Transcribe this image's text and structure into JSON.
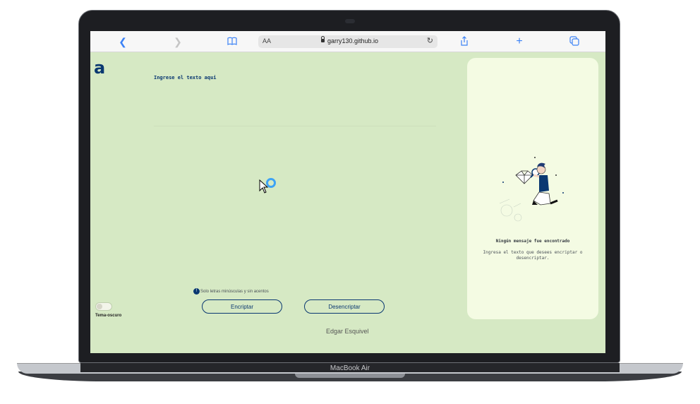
{
  "device": {
    "brand_label": "MacBook Air"
  },
  "browser": {
    "address_text_size": "AA",
    "url": "garry130.github.io",
    "icons": [
      "back-icon",
      "forward-icon",
      "bookmarks-icon",
      "lock-icon",
      "reload-icon",
      "share-icon",
      "new-tab-icon",
      "tabs-icon"
    ]
  },
  "page": {
    "logo": "a",
    "input_placeholder": "Ingrese el texto aqui",
    "notice": "Solo letras minúsculas y sin acentos",
    "encrypt_label": "Encriptar",
    "decrypt_label": "Desencriptar",
    "theme_toggle_label": "Tema-oscuro",
    "footer": "Edgar Esquivel",
    "colors": {
      "background": "#d6e9c4",
      "accent": "#0a3871",
      "panel": "#f4fbe3"
    }
  },
  "result_panel": {
    "title": "Ningún mensaje fue encontrado",
    "text": "Ingresa el texto que desees encriptar o desencriptar."
  }
}
